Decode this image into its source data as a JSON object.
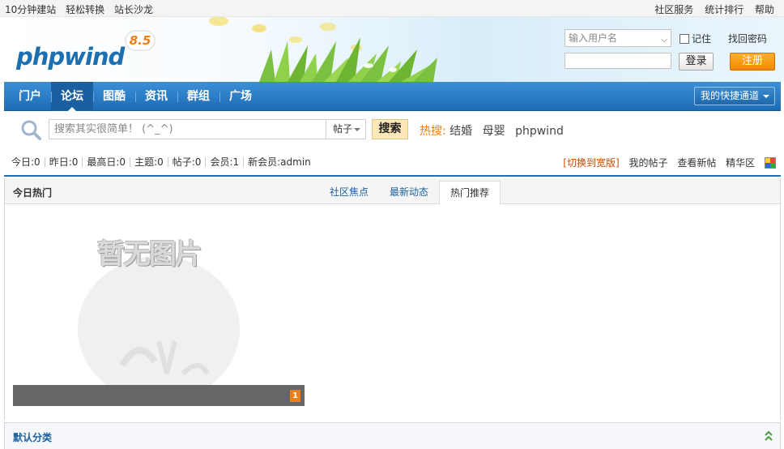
{
  "topbar": {
    "left_links": [
      "10分钟建站",
      "轻松转换",
      "站长沙龙"
    ],
    "right_links": [
      "社区服务",
      "统计排行",
      "帮助"
    ]
  },
  "header": {
    "logo_text": "phpwind",
    "version": "8.5",
    "login": {
      "username_placeholder": "输入用户名",
      "remember_label": "记住",
      "find_password": "找回密码",
      "login_button": "登录",
      "register_button": "注册"
    }
  },
  "nav": {
    "items": [
      "门户",
      "论坛",
      "图酷",
      "资讯",
      "群组",
      "广场"
    ],
    "active": "论坛",
    "quick_access": "我的快捷通道"
  },
  "search": {
    "placeholder": "搜索其实很简单！ (^_^)",
    "type": "帖子",
    "button": "搜索",
    "hot_label": "热搜:",
    "hot_keywords": [
      "结婚",
      "母婴",
      "phpwind"
    ]
  },
  "stats": {
    "items": [
      "今日:0",
      "昨日:0",
      "最高日:0",
      "主题:0",
      "帖子:0",
      "会员:1",
      "新会员:admin"
    ],
    "switch_wide": "[切换到宽版]",
    "links": [
      "我的帖子",
      "查看新帖",
      "精华区"
    ]
  },
  "hot_panel": {
    "title": "今日热门",
    "tabs": [
      "社区焦点",
      "最新动态",
      "热门推荐"
    ],
    "active_tab": "热门推荐",
    "placeholder_image_text": "暂无图片",
    "pager": "1"
  },
  "category": {
    "title": "默认分类"
  },
  "colors": {
    "nav_blue": "#1d6db6",
    "accent_orange": "#ef7d13",
    "link_blue": "#1a5f9f"
  },
  "icons": {
    "search": "magnifier-icon",
    "collapse": "double-chevron-up-icon",
    "color_picker": "color-swatch-icon"
  }
}
